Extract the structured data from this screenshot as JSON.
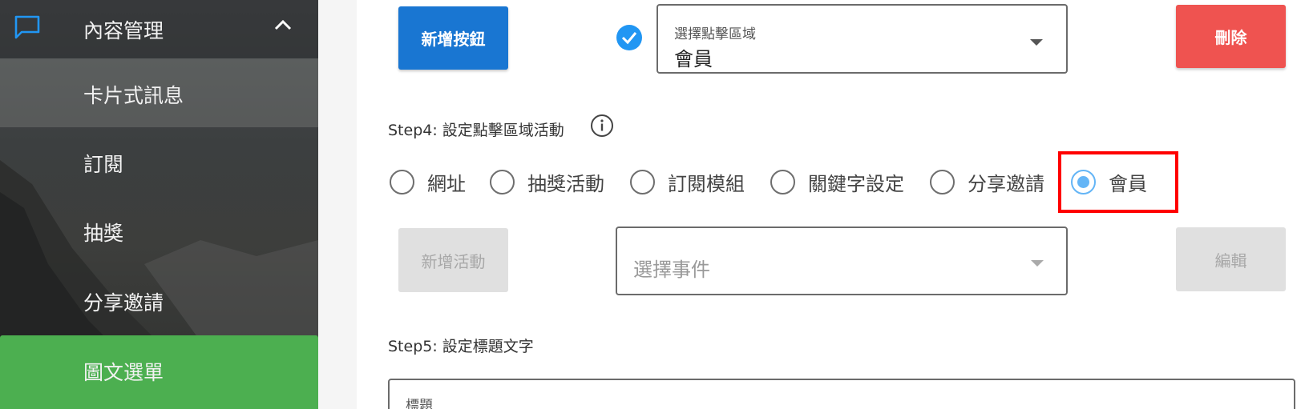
{
  "sidebar": {
    "header": {
      "label": "內容管理",
      "icon": "chat-bubble-icon",
      "toggle_icon": "chevron-up-icon"
    },
    "items": [
      {
        "label": "卡片式訊息"
      },
      {
        "label": "訂閱"
      },
      {
        "label": "抽獎"
      },
      {
        "label": "分享邀請"
      },
      {
        "label": "圖文選單"
      }
    ]
  },
  "step3": {
    "add_button_label": "新增按鈕",
    "area_select": {
      "label": "選擇點擊區域",
      "value": "會員"
    },
    "delete_button_label": "刪除"
  },
  "step4": {
    "title": "Step4: 設定點擊區域活動",
    "radio_options": [
      {
        "label": "網址",
        "checked": false
      },
      {
        "label": "抽獎活動",
        "checked": false
      },
      {
        "label": "訂閱模組",
        "checked": false
      },
      {
        "label": "關鍵字設定",
        "checked": false
      },
      {
        "label": "分享邀請",
        "checked": false
      },
      {
        "label": "會員",
        "checked": true
      }
    ],
    "add_activity_button_label": "新增活動",
    "event_select_placeholder": "選擇事件",
    "edit_button_label": "編輯"
  },
  "step5": {
    "title": "Step5: 設定標題文字",
    "title_field_label": "標題"
  },
  "colors": {
    "primary": "#1976d2",
    "danger": "#ef5350",
    "active_menu": "#4caf50",
    "radio_checked": "#64b5f6",
    "highlight": "#ff0000"
  }
}
